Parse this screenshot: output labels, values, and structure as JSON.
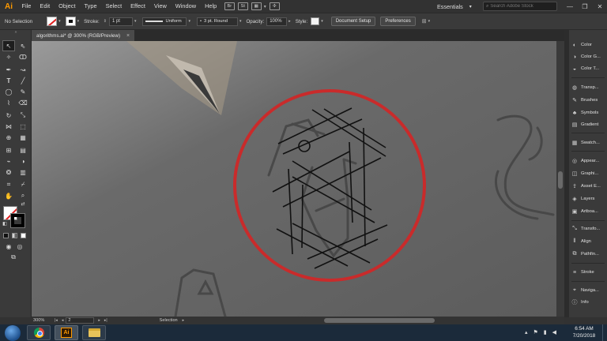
{
  "app": {
    "logo": "Ai",
    "menu": [
      "File",
      "Edit",
      "Object",
      "Type",
      "Select",
      "Effect",
      "View",
      "Window",
      "Help"
    ],
    "bridge_chips": [
      "Br",
      "St"
    ],
    "workspace": "Essentials",
    "search_placeholder": "Search Adobe Stock",
    "window_buttons": [
      "—",
      "❐",
      "✕"
    ]
  },
  "control_bar": {
    "selection_label": "No Selection",
    "stroke_label": "Stroke:",
    "stroke_weight": "1 pt",
    "profile": "Uniform",
    "brush": "3 pt. Round",
    "opacity_label": "Opacity:",
    "opacity_value": "100%",
    "style_label": "Style:",
    "document_setup": "Document Setup",
    "preferences": "Preferences"
  },
  "document": {
    "tab_title": "algorithms.ai* @ 300% (RGB/Preview)",
    "close_glyph": "×"
  },
  "status_bar": {
    "zoom": "300%",
    "page": "2",
    "tool_label": "Selection"
  },
  "right_panels": [
    {
      "label": "Color",
      "icon": "color-icon"
    },
    {
      "label": "Color G...",
      "icon": "color-guide-icon"
    },
    {
      "label": "Color T...",
      "icon": "color-themes-icon"
    },
    {
      "label": "Transp...",
      "icon": "transparency-icon"
    },
    {
      "label": "Brushes",
      "icon": "brushes-icon"
    },
    {
      "label": "Symbols",
      "icon": "symbols-icon"
    },
    {
      "label": "Gradient",
      "icon": "gradient-icon"
    },
    {
      "label": "Swatch...",
      "icon": "swatches-icon"
    },
    {
      "label": "Appear...",
      "icon": "appearance-icon"
    },
    {
      "label": "Graphi...",
      "icon": "graphic-styles-icon"
    },
    {
      "label": "Asset E...",
      "icon": "asset-export-icon"
    },
    {
      "label": "Layers",
      "icon": "layers-icon"
    },
    {
      "label": "Artboa...",
      "icon": "artboards-icon"
    },
    {
      "label": "Transfo...",
      "icon": "transform-icon"
    },
    {
      "label": "Align",
      "icon": "align-icon"
    },
    {
      "label": "Pathfin...",
      "icon": "pathfinder-icon"
    },
    {
      "label": "Stroke",
      "icon": "stroke-icon"
    },
    {
      "label": "Naviga...",
      "icon": "navigator-icon"
    },
    {
      "label": "Info",
      "icon": "info-icon"
    }
  ],
  "taskbar": {
    "time": "6:54 AM",
    "date": "7/20/2018"
  },
  "colors": {
    "accent_orange": "#ff9a00",
    "highlight_red": "#c92b2b",
    "canvas_gray": "#5f5f5f"
  }
}
